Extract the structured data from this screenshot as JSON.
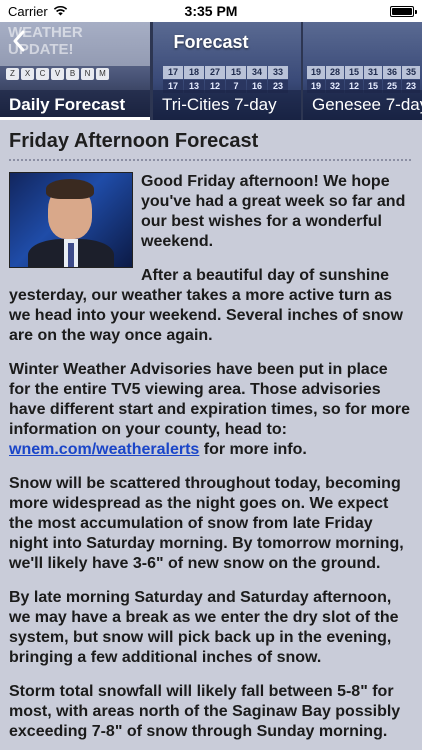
{
  "status_bar": {
    "carrier": "Carrier",
    "time": "3:35 PM",
    "icons": [
      "wifi-icon",
      "battery-icon"
    ]
  },
  "nav": {
    "title": "Forecast",
    "back_icon": "chevron-left-icon"
  },
  "tabs": [
    {
      "label": "Daily Forecast",
      "active": true
    },
    {
      "label": "Tri-Cities 7-day",
      "active": false
    },
    {
      "label": "Genesee 7-day",
      "active": false
    }
  ],
  "thumb_text": {
    "weather_update": "WEATHER UPDATE!",
    "keyboard_keys": [
      "Z",
      "X",
      "C",
      "V",
      "B",
      "N",
      "M"
    ],
    "tricities_numbers": [
      "17",
      "18",
      "27",
      "15",
      "34",
      "33",
      "17",
      "13",
      "12",
      "7",
      "16",
      "23"
    ],
    "genesee_numbers": [
      "19",
      "28",
      "15",
      "31",
      "36",
      "35",
      "19",
      "32",
      "12",
      "15",
      "25",
      "23"
    ]
  },
  "article": {
    "headline": "Friday Afternoon Forecast",
    "p1": "Good Friday afternoon! We hope you've had a great week so far and our best wishes for a wonderful weekend.",
    "p2": "After a beautiful day of sunshine yesterday, our weather takes a more active turn as we head into your weekend. Several inches of snow are on the way once again.",
    "p3_before": "Winter Weather Advisories have been put in place for the entire TV5 viewing area. Those advisories have different start and expiration times, so for more information on your county, head to: ",
    "p3_link": "wnem.com/weatheralerts",
    "p3_after": " for more info.",
    "p4": "Snow will be scattered throughout today, becoming more widespread as the night goes on. We expect the most accumulation of snow from late Friday night into Saturday morning. By tomorrow morning, we'll likely have 3-6\" of new snow on the ground.",
    "p5": "By late morning Saturday and Saturday afternoon, we may have a break as we enter the dry slot of the system, but snow will pick back up in the evening, bringing a few additional inches of snow.",
    "p6": "Storm total snowfall will likely fall between 5-8\" for most, with areas north of the Saginaw Bay possibly exceeding 7-8\" of snow through Sunday morning."
  }
}
